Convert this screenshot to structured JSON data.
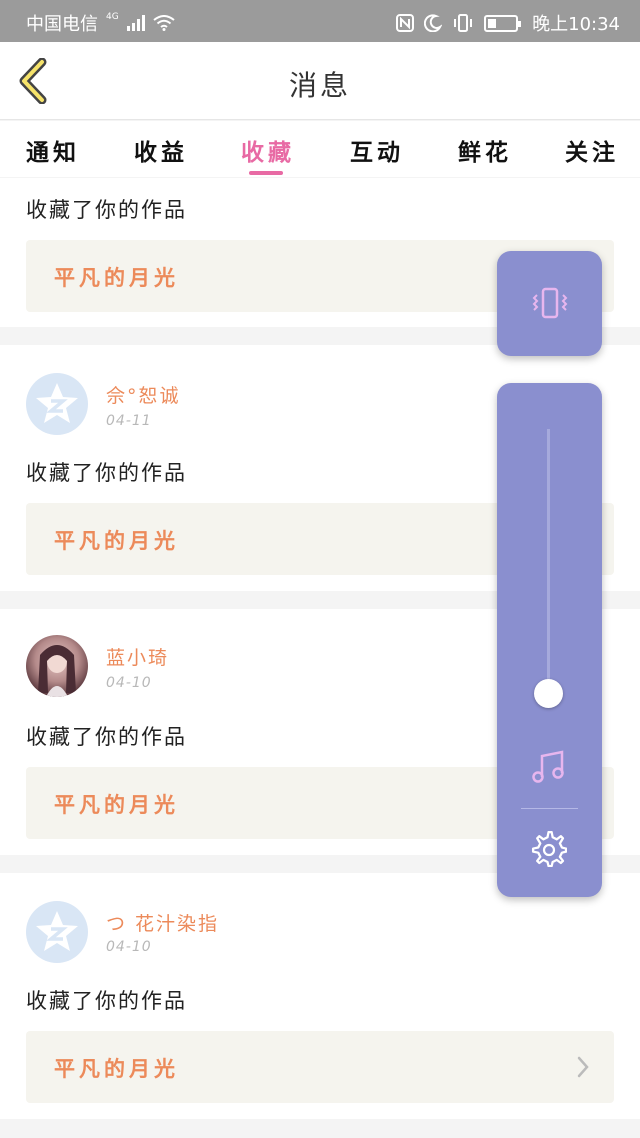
{
  "status_bar": {
    "carrier": "中国电信",
    "network": "4G",
    "time": "晚上10:34"
  },
  "header": {
    "title": "消息",
    "back_icon": "chevron-left-icon"
  },
  "tabs": [
    {
      "label": "通知",
      "active": false
    },
    {
      "label": "收益",
      "active": false
    },
    {
      "label": "收藏",
      "active": true
    },
    {
      "label": "互动",
      "active": false
    },
    {
      "label": "鲜花",
      "active": false
    },
    {
      "label": "关注",
      "active": false
    }
  ],
  "messages": [
    {
      "username": "",
      "date": "",
      "action": "收藏了你的作品",
      "work_title": "平凡的月光"
    },
    {
      "username": "佘°恕诚",
      "date": "04-11",
      "action": "收藏了你的作品",
      "work_title": "平凡的月光",
      "avatar": "default"
    },
    {
      "username": "蓝小琦",
      "date": "04-10",
      "action": "收藏了你的作品",
      "work_title": "平凡的月光",
      "avatar": "photo"
    },
    {
      "username": "つ 花汁染指",
      "date": "04-10",
      "action": "收藏了你的作品",
      "work_title": "平凡的月光",
      "avatar": "default"
    }
  ],
  "volume_panel": {
    "vibrate_icon": "vibrate-icon",
    "music_icon": "music-note-icon",
    "settings_icon": "gear-icon",
    "level": 0.05
  },
  "colors": {
    "accent": "#e86aa4",
    "username": "#ec8a5a",
    "panel": "#8a8fcf"
  }
}
